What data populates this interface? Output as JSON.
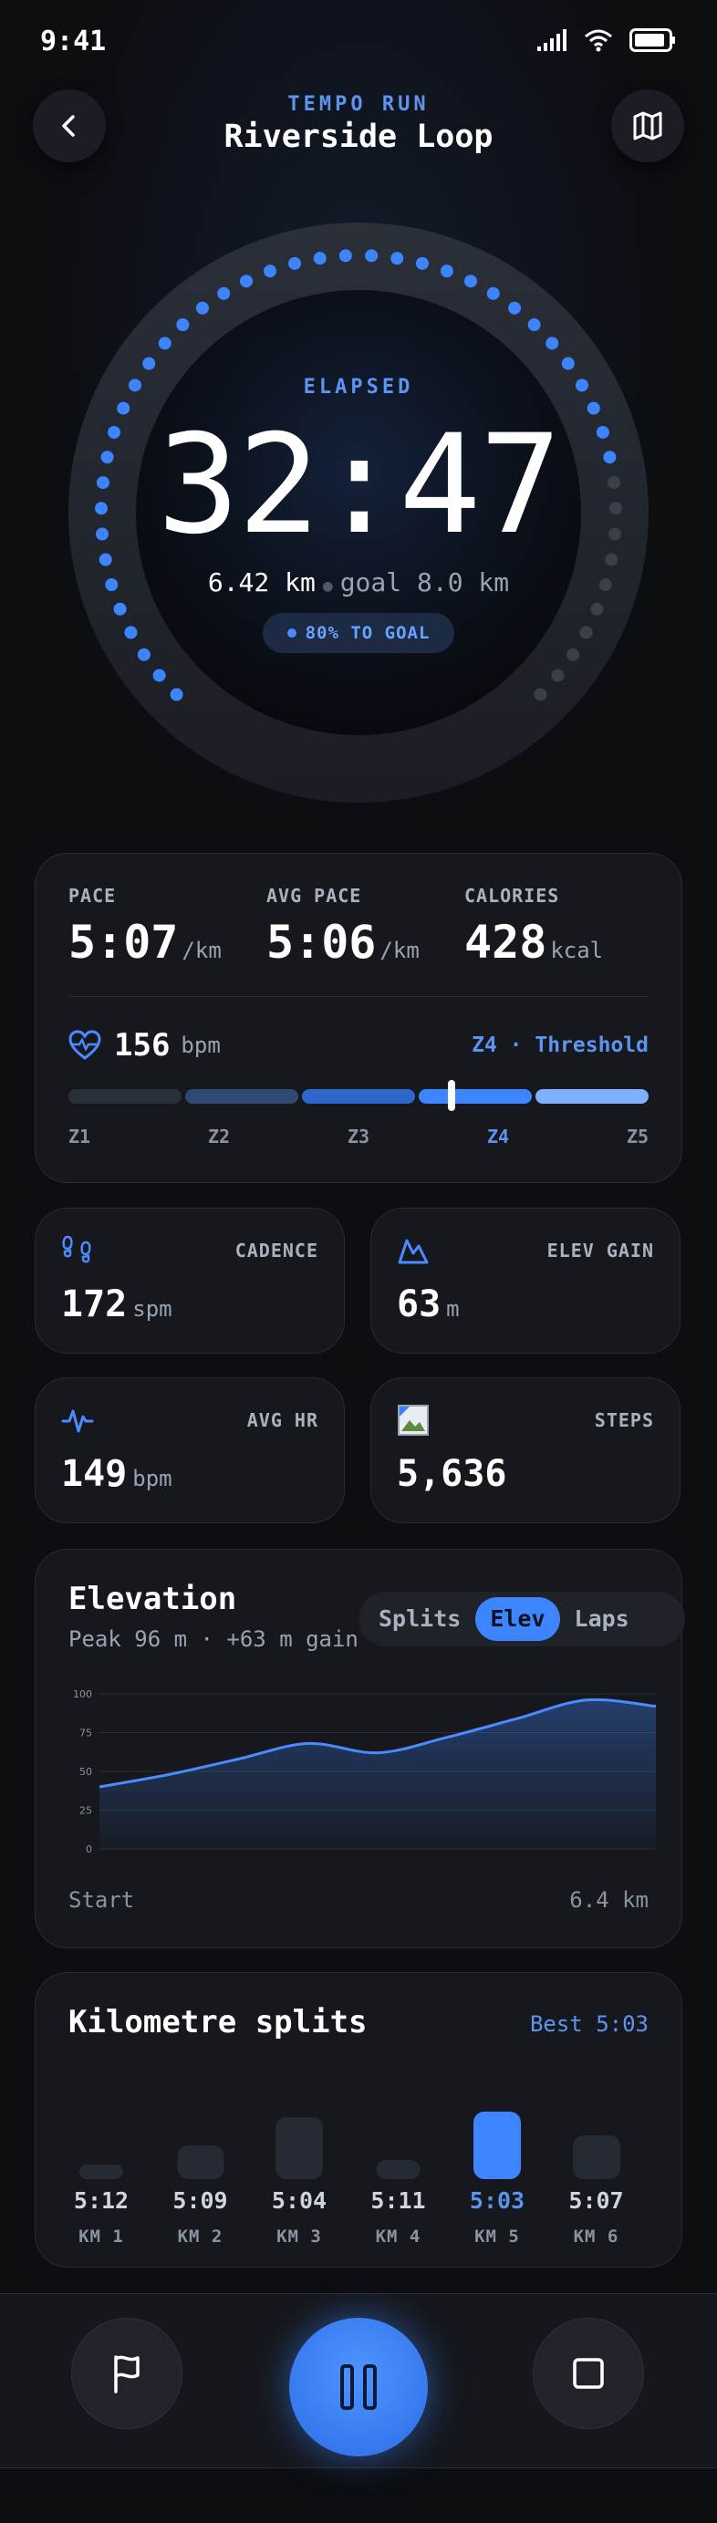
{
  "status": {
    "time": "9:41"
  },
  "header": {
    "workout_type": "TEMPO RUN",
    "route_name": "Riverside Loop"
  },
  "timer": {
    "label": "ELAPSED",
    "elapsed": "32:47",
    "distance": "6.42 km",
    "goal": "goal 8.0 km",
    "goal_pill": "80% TO GOAL",
    "progress_fraction": 0.8,
    "accent": "#3d84ff"
  },
  "stats": {
    "pace": {
      "label": "PACE",
      "value": "5:07",
      "unit": "/km"
    },
    "avg_pace": {
      "label": "AVG PACE",
      "value": "5:06",
      "unit": "/km"
    },
    "calories": {
      "label": "CALORIES",
      "value": "428",
      "unit": "kcal"
    }
  },
  "heart_rate": {
    "value": "156",
    "unit": "bpm",
    "zone_text": "Z4 · Threshold",
    "zones": [
      "Z1",
      "Z2",
      "Z3",
      "Z4",
      "Z5"
    ],
    "active_zone": 3,
    "marker_fraction": 0.66,
    "zone_colors": [
      "#2a303a",
      "#2f4a72",
      "#2f66c9",
      "#3d84ff",
      "#7fb0ff"
    ]
  },
  "metrics": {
    "cadence": {
      "label": "CADENCE",
      "value": "172",
      "unit": "spm",
      "icon": "footsteps-icon"
    },
    "elev_gain": {
      "label": "ELEV GAIN",
      "value": "63",
      "unit": "m",
      "icon": "mountain-icon"
    },
    "avg_hr": {
      "label": "AVG HR",
      "value": "149",
      "unit": "bpm",
      "icon": "pulse-icon"
    },
    "steps": {
      "label": "STEPS",
      "value": "5,636",
      "icon": "steps-image-icon"
    }
  },
  "elevation": {
    "title": "Elevation",
    "subtitle": "Peak 96 m · +63 m gain",
    "tabs": [
      "Splits",
      "Elev",
      "Laps"
    ],
    "active_tab": "Elev",
    "start_label": "Start",
    "end_label": "6.4 km"
  },
  "chart_data": {
    "type": "area",
    "x": [
      0,
      0.8,
      1.6,
      2.4,
      3.2,
      4.0,
      4.8,
      5.6,
      6.4
    ],
    "values": [
      40,
      48,
      58,
      68,
      62,
      72,
      84,
      96,
      92
    ],
    "yticks": [
      "0",
      "25",
      "50",
      "75",
      "100"
    ],
    "ylim": [
      0,
      100
    ],
    "grid": true,
    "line_color": "#4b8bff"
  },
  "splits": {
    "title": "Kilometre splits",
    "best": "Best 5:03",
    "items": [
      {
        "time": "5:12",
        "km": "KM 1",
        "height": 0.22
      },
      {
        "time": "5:09",
        "km": "KM 2",
        "height": 0.5
      },
      {
        "time": "5:04",
        "km": "KM 3",
        "height": 0.92
      },
      {
        "time": "5:11",
        "km": "KM 4",
        "height": 0.28
      },
      {
        "time": "5:03",
        "km": "KM 5",
        "height": 1.0,
        "best": true
      },
      {
        "time": "5:07",
        "km": "KM 6",
        "height": 0.65
      }
    ]
  },
  "controls": {
    "lap_icon": "flag-icon",
    "pause_icon": "pause-icon",
    "stop_icon": "stop-icon"
  }
}
